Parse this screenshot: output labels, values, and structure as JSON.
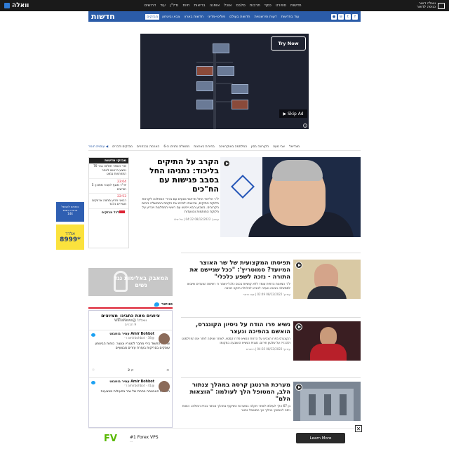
{
  "topbar": {
    "logo": "וואלה",
    "nav": [
      "חדשות",
      "ספורט",
      "כסף",
      "תרבות",
      "סלבס",
      "אוכל",
      "אופנה",
      "בריאות",
      "חיות",
      "נדל\"ן",
      "עוד",
      "דרושים"
    ],
    "mail_line1": "וואלה דואר",
    "mail_line2": "כניסה לדואר"
  },
  "section": {
    "title": "חדשות",
    "tabs": [
      "מבזקים",
      "צבא וביטחון",
      "חדשות בארץ",
      "פוליטי-מדיני",
      "חדשות בעולם",
      "דעות ופרשנויות",
      "עוד בחדשות"
    ],
    "social": [
      "f",
      "t",
      "w",
      "●"
    ]
  },
  "ad": {
    "try_label": "Try Now",
    "skip_label": "Skip Ad ▶",
    "info_label": "i"
  },
  "breadcrumb": [
    "מבזקים ודברים",
    "הארמה בנבחרים",
    "ממשלת נתניהו ה-6",
    "בחירות בארצות",
    "המלחמה באוקראינה",
    "הקורונה בסין",
    "אבי מעוז",
    "מונדיאל"
  ],
  "breadcrumb_home": "עוסוית חומר ◀",
  "side_ads": {
    "banner1": "כוחכים להבשל\nאהבה ותגוש\n144",
    "banner2_logo": "אלדד",
    "banner2_num": "*8999"
  },
  "flash": {
    "header": "מבזקי חדשות",
    "items": [
      {
        "time": "",
        "text": "שרי השמר חולים: גבר 70 נפצע בראשו לאחר התפרצות במוט"
      },
      {
        "time": "23:04",
        "text": "יוד\"ר מנגף לעבור מתוכן: 5 חודשים"
      },
      {
        "time": "22:53",
        "text": "רבאני פרוע מתווה ארווקים מגוירים בלבד"
      }
    ],
    "all_label": "לכל מבזקים"
  },
  "lead": {
    "title": "הקרב על התיקים בליכוד: נתניהו החל בסבב פגישות עם הח\"כים",
    "summary": "יו\"ר הליכוד החל מראשי מגעים עם בכירי המפלגה לקראת חלוקת התיקים, ובכוונתו לסיים את הקמת הממשלה בימים הקרובים. בשבוע הבא ייפגש עם ראשי המפלגות ויכריע על חלוקת החותמות והוועדות",
    "meta": "עודכן: 08/12/2022 04:22 | טל שלו"
  },
  "stories": [
    {
      "title": "תפיסתו המקצועית של שר האוצר המיועד? סמוטריץ': \"ככל שניישם את התורה - נזכה לשפע כלכלי\"",
      "summary": "יו\"ר הציונות הדתית עומד ללא קושיות בכנס כלכלי ואמר כי רשימת הצעדים שיובאו לממשלה הבאה נועדה להביא לכלכלה חזקה ויציבה",
      "meta": "עודכן: 08/12/2022 02:49 | קינו רוזנר"
    },
    {
      "title": "נשיא פרו הודח על ניסיון הקונגרס, הואשם בהפיכה ונעצר",
      "summary": "הקונגרס בפרו הצביע על הדחת הנשיא פדרו קסטיו, לאחר שניסה לפזר את הפרלמנט ולהכריז על שלטון חירום. סגנית הנשיא הושבעה במקומו",
      "meta": "עודכן: 08/12/2022 04:35 | רויטרס"
    },
    {
      "title": "מערכת הרנטגן קרסה במהלך צנתור הלב, המטופל הלך לעולמו: \"הוצאות הלם\"",
      "summary": "בן 67 הלך לעולמו לאחר תקלה במערכת השיקוף במהלך צנתור בבית החולים. הצוות ניסה להמשיך בהליך אך המטופל נפטר",
      "meta": ""
    }
  ],
  "promo": {
    "text": "המאבק באלימות נגד נשים"
  },
  "twitter": {
    "header": "טוויטר",
    "title": "ציוצים מאת כתבינו_מציוצים",
    "account": "וואלה! @WallaNews",
    "members": "9 חברים",
    "tweets": [
      {
        "name": "Amir Bohbot עמיר בוחבוט",
        "handle": "@amirbohbot · 38 ד׳",
        "body": "צה\"ל: החשוד בירי מחבר למגוריו ונעצר. כוחות הביטחון עוסקים בסריקות בעזרת עזרים מבצעיים",
        "replies": "",
        "likes": "2",
        "shares": "↻"
      },
      {
        "name": "Amir Bohbot עמיר בוחבוט",
        "handle": "@amirbohbot · 41 ד׳",
        "body": "הכוחות האבטחה בחתת של גבר בפעולות מבצעיות",
        "replies": "",
        "likes": "",
        "shares": ""
      }
    ]
  },
  "bottom_ad": {
    "logo": "FV",
    "title": "#1 Forex VPS",
    "subtitle": "...",
    "button": "Learn More",
    "close": "✕"
  }
}
